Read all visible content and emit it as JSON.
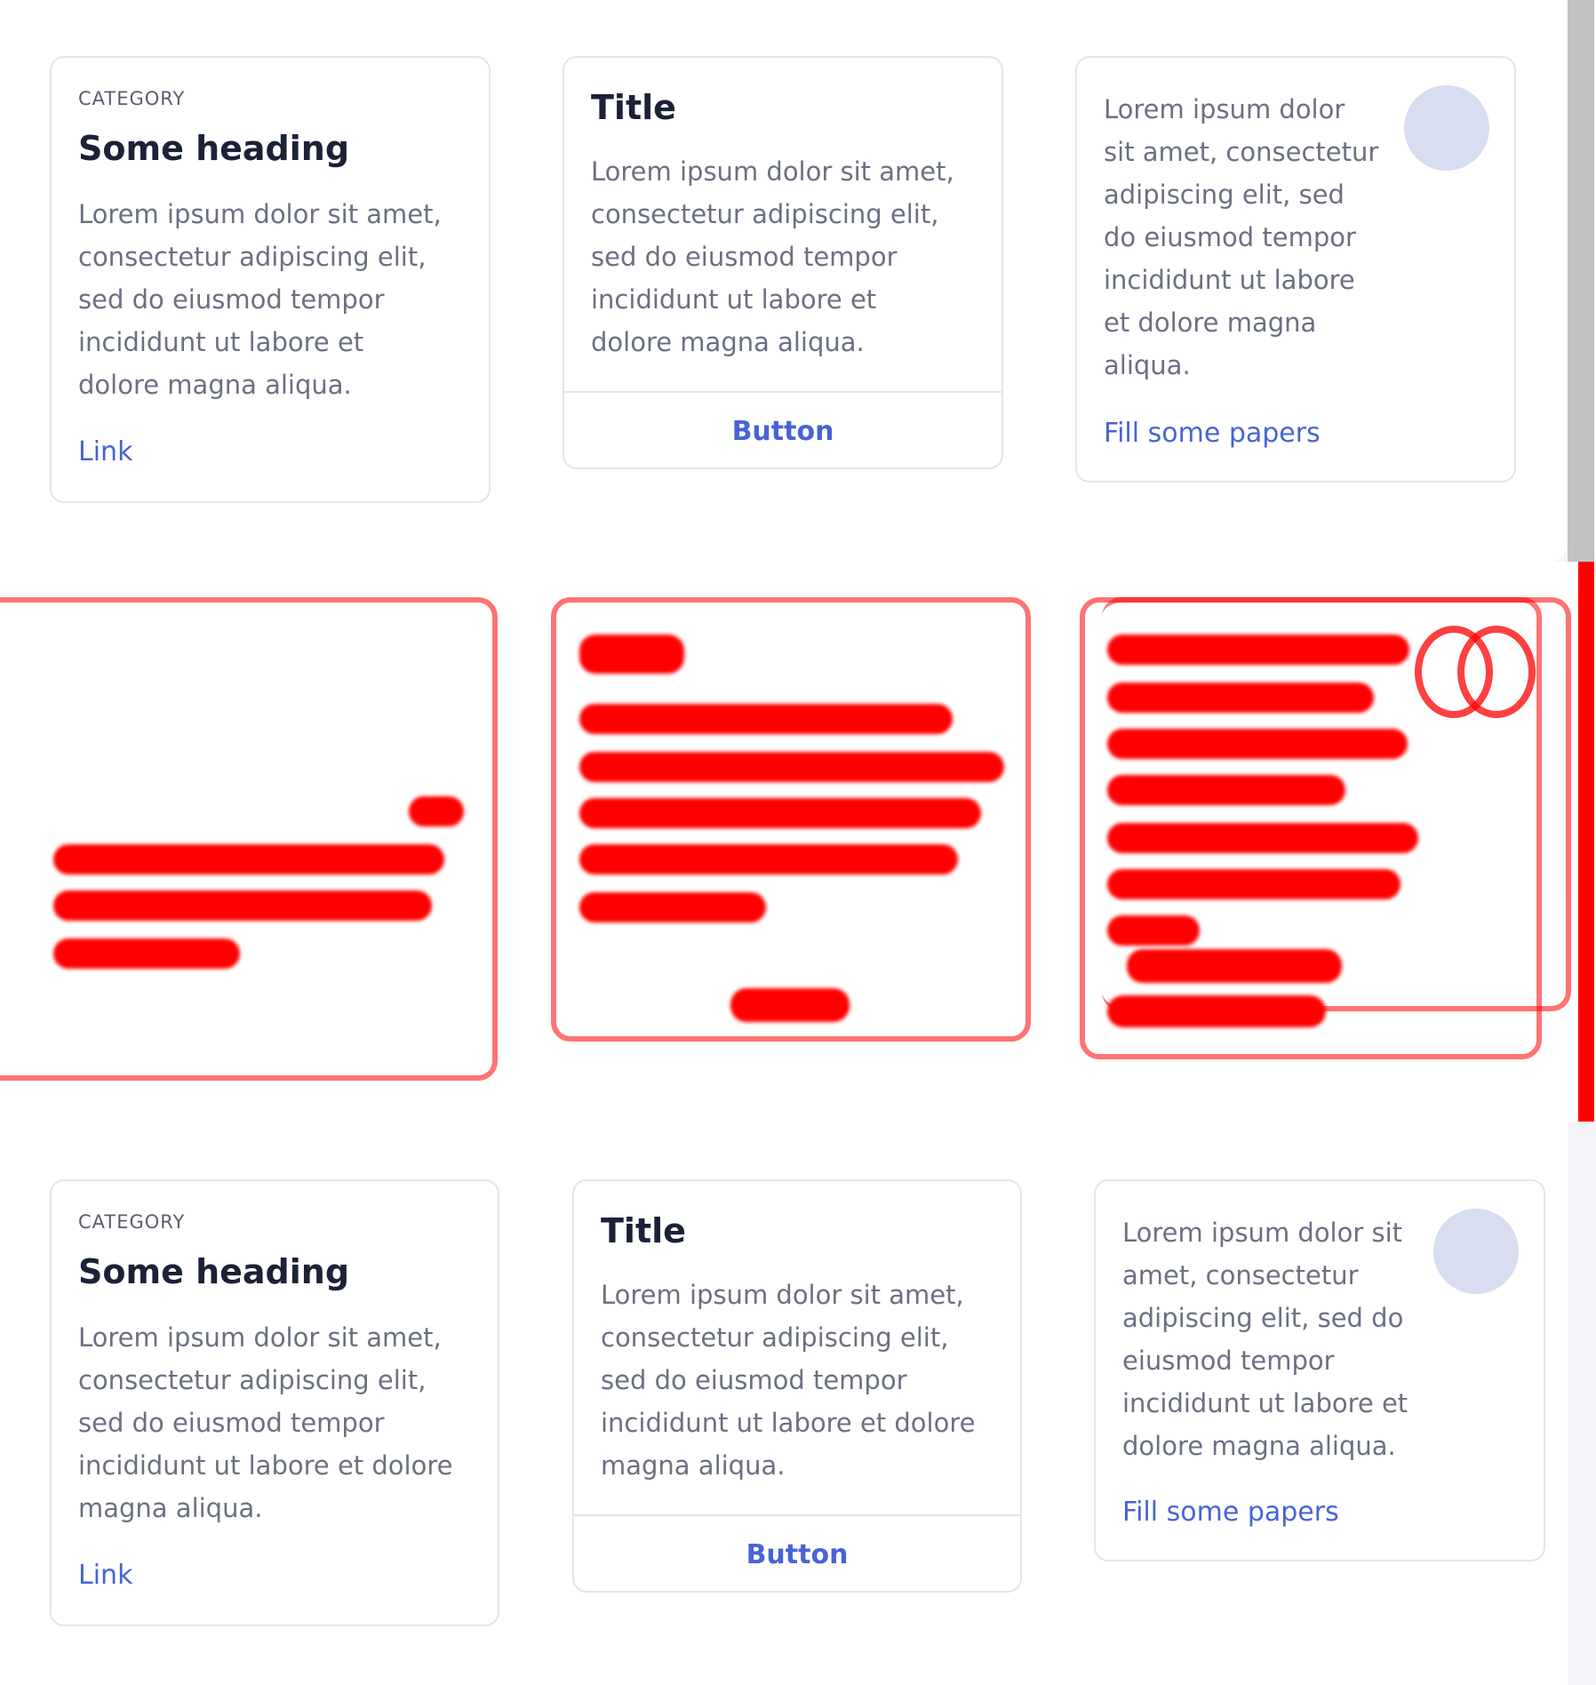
{
  "top": {
    "card1": {
      "category": "CATEGORY",
      "heading": "Some heading",
      "body": "Lorem ipsum dolor sit amet, consectetur adipiscing elit, sed do eiusmod tempor incididunt ut labore et dolore magna aliqua.",
      "link": "Link"
    },
    "card2": {
      "title": "Title",
      "body": "Lorem ipsum dolor sit amet, consectetur adipiscing elit, sed do eiusmod tempor incididunt ut labore et dolore magna aliqua.",
      "button": "Button"
    },
    "card3": {
      "body": "Lorem ipsum dolor sit amet, consectetur adipiscing elit, sed do eiusmod tempor incididunt ut labore et dolore magna aliqua.",
      "link": "Fill some papers"
    }
  },
  "bottom": {
    "card1": {
      "category": "CATEGORY",
      "heading": "Some heading",
      "body": "Lorem ipsum dolor sit amet, consectetur adipiscing elit, sed do eiusmod tempor incididunt ut labore et dolore magna aliqua.",
      "link": "Link"
    },
    "card2": {
      "title": "Title",
      "body": "Lorem ipsum dolor sit amet, consectetur adipiscing elit, sed do eiusmod tempor incididunt ut labore et dolore magna aliqua.",
      "button": "Button"
    },
    "card3": {
      "body": "Lorem ipsum dolor sit amet, consectetur adipiscing elit, sed do eiusmod tempor incididunt ut labore et dolore magna aliqua.",
      "link": "Fill some papers"
    }
  },
  "colors": {
    "accent": "#4863d6",
    "heading": "#1b2137",
    "body_text": "#6b7082",
    "card_border": "#e4e6ed",
    "avatar": "#d8ddf0",
    "diff_highlight": "#ff0000",
    "scrollbar": "#c2c2c2"
  }
}
